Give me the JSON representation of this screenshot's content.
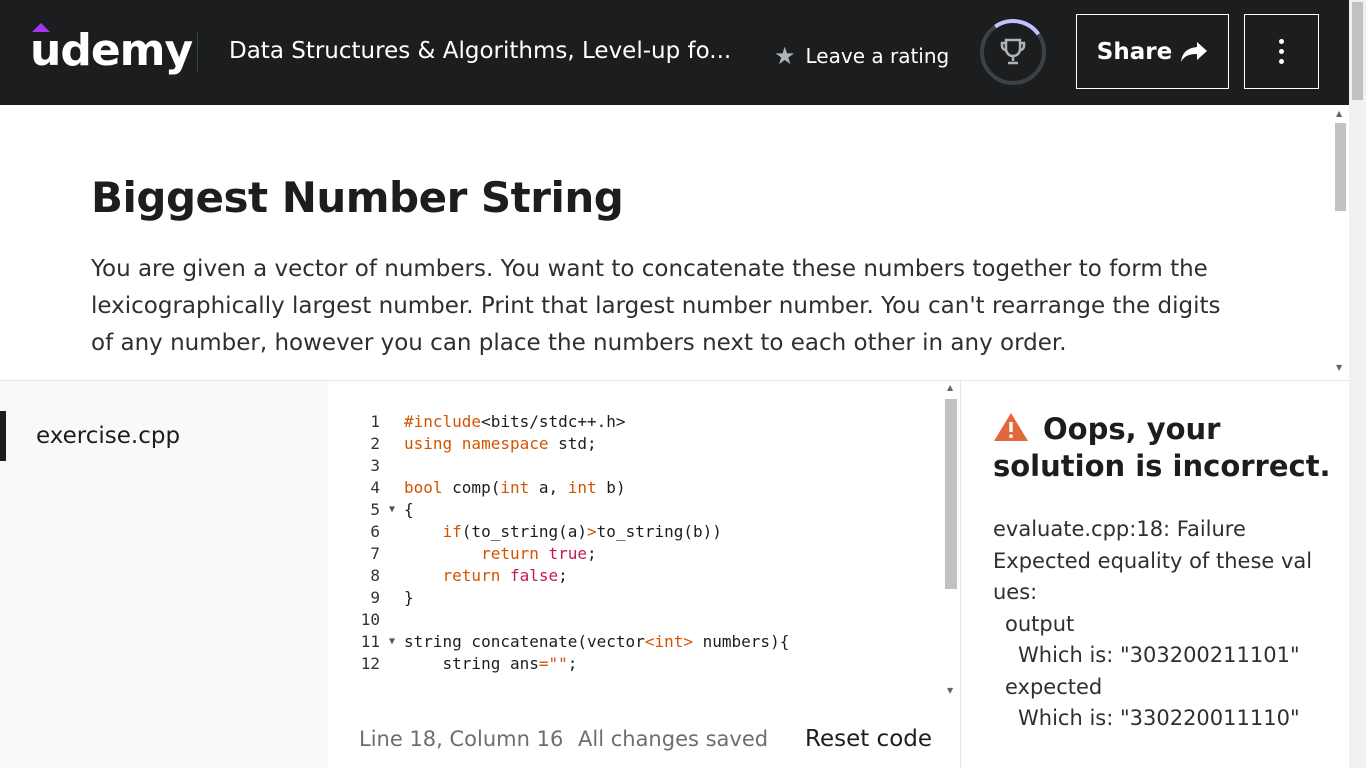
{
  "header": {
    "logo": "udemy",
    "course_title": "Data Structures & Algorithms, Level-up fo...",
    "rating_label": "Leave a rating",
    "share_label": "Share",
    "colors": {
      "background": "#1c1d1f",
      "brand": "#a435f0"
    }
  },
  "question": {
    "title": "Biggest Number String",
    "description": "You are given a vector of numbers. You want to concatenate these numbers together to form the lexicographically largest number. Print that largest number number. You can't rearrange the digits of any number, however you can place the numbers next to each other in any order."
  },
  "files": [
    {
      "name": "exercise.cpp",
      "active": true
    }
  ],
  "editor": {
    "lines": [
      {
        "n": "1",
        "fold": "",
        "code": "#include<bits/stdc++.h>"
      },
      {
        "n": "2",
        "fold": "",
        "code": "using namespace std;"
      },
      {
        "n": "3",
        "fold": "",
        "code": ""
      },
      {
        "n": "4",
        "fold": "",
        "code": "bool comp(int a, int b)"
      },
      {
        "n": "5",
        "fold": "▼",
        "code": "{"
      },
      {
        "n": "6",
        "fold": "",
        "code": "    if(to_string(a)>to_string(b))"
      },
      {
        "n": "7",
        "fold": "",
        "code": "        return true;"
      },
      {
        "n": "8",
        "fold": "",
        "code": "    return false;"
      },
      {
        "n": "9",
        "fold": "",
        "code": "}"
      },
      {
        "n": "10",
        "fold": "",
        "code": ""
      },
      {
        "n": "11",
        "fold": "▼",
        "code": "string concatenate(vector<int> numbers){"
      },
      {
        "n": "12",
        "fold": "",
        "code": "    string ans=\"\";"
      }
    ],
    "status_position": "Line 18, Column 16",
    "status_saved": "All changes saved",
    "reset_label": "Reset code"
  },
  "result": {
    "title": "Oops, your solution is incorrect.",
    "icon": "warning-icon",
    "icon_color": "#e2673c",
    "line1": "evaluate.cpp:18: Failure",
    "line2": "Expected equality of these values:",
    "line3": "output",
    "line4": "Which is: \"303200211101\"",
    "line5": "expected",
    "line6": "Which is: \"330220011110\""
  }
}
